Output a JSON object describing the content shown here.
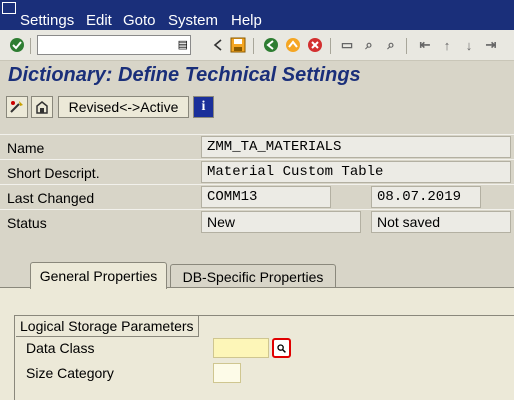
{
  "menubar": {
    "items": [
      "Settings",
      "Edit",
      "Goto",
      "System",
      "Help"
    ],
    "bg_color": "#1a2f7a"
  },
  "toolbar": {
    "command_value": "",
    "icons": [
      "enter-icon",
      "history-icon",
      "back-arrow-icon",
      "save-icon",
      "back-icon",
      "exit-icon",
      "cancel-icon",
      "print-icon",
      "find-icon",
      "find-next-icon",
      "first-page-icon",
      "previous-page-icon",
      "next-page-icon",
      "last-page-icon"
    ]
  },
  "page": {
    "title": "Dictionary: Define Technical Settings",
    "title_color": "#1a2f7a"
  },
  "app_toolbar": {
    "revised_active_label": "Revised<->Active"
  },
  "header": {
    "name_label": "Name",
    "name_value": "ZMM_TA_MATERIALS",
    "short_descr_label": "Short Descript.",
    "short_descr_value": "Material Custom Table",
    "last_changed_label": "Last Changed",
    "last_changed_user": "COMM13",
    "last_changed_date": "08.07.2019",
    "status_label": "Status",
    "status_value": "New",
    "save_status": "Not saved"
  },
  "tabs": [
    {
      "label": "General Properties",
      "active": true
    },
    {
      "label": "DB-Specific Properties",
      "active": false
    }
  ],
  "logical_storage": {
    "group_title": "Logical Storage Parameters",
    "data_class_label": "Data Class",
    "data_class_value": "",
    "size_category_label": "Size Category",
    "size_category_value": ""
  },
  "colors": {
    "required_field": "#fdf6b8",
    "highlight_box": "#e00000"
  }
}
